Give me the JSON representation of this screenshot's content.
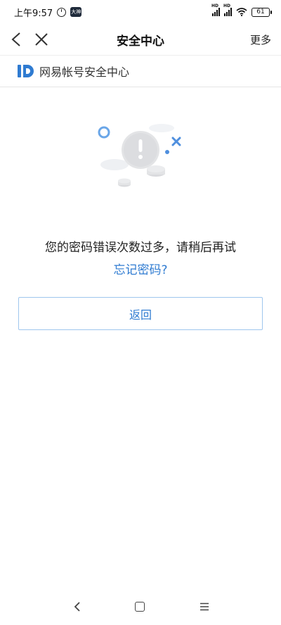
{
  "status_bar": {
    "time": "上午9:57",
    "app_badge": "大神",
    "signal_label": "HD",
    "battery": "61"
  },
  "nav": {
    "title": "安全中心",
    "more": "更多"
  },
  "brand": {
    "text": "网易帐号安全中心",
    "color": "#2f7bd1"
  },
  "main": {
    "message": "您的密码错误次数过多，请稍后再试",
    "forgot_link": "忘记密码?",
    "back_button": "返回"
  },
  "colors": {
    "accent": "#2f7bd1",
    "button_border": "#9fc6ee"
  }
}
